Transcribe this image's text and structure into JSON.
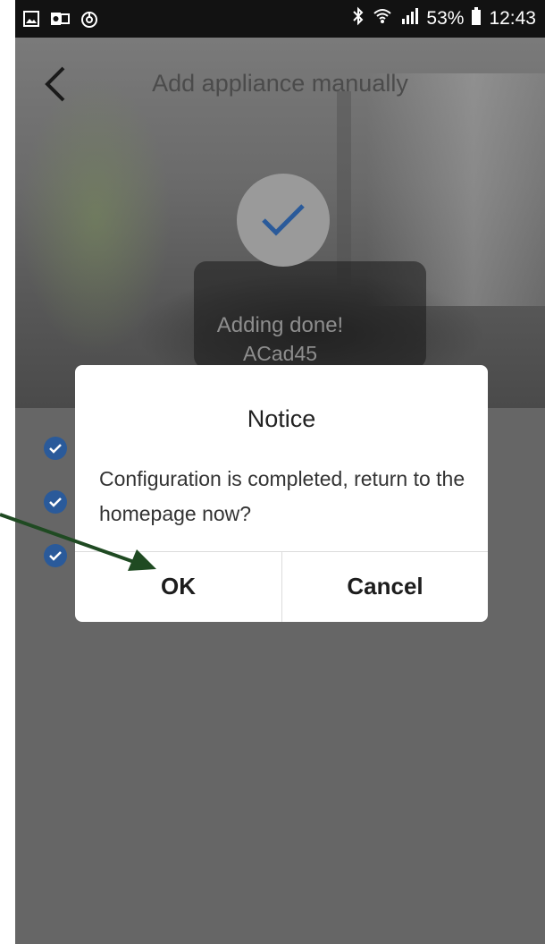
{
  "status_bar": {
    "battery": "53%",
    "time": "12:43",
    "icons_left": [
      "gallery-icon",
      "outlook-icon",
      "sync-icon"
    ],
    "icons_right": [
      "bluetooth-icon",
      "wifi-icon",
      "signal-icon",
      "battery-icon"
    ]
  },
  "header": {
    "title": "Add appliance manually",
    "back_icon": "chevron-left-icon"
  },
  "status": {
    "message": "Adding done!",
    "device_name": "ACad45"
  },
  "dialog": {
    "title": "Notice",
    "message": "Configuration is completed, return to the homepage now?",
    "ok_label": "OK",
    "cancel_label": "Cancel"
  },
  "colors": {
    "accent": "#2a5a9a",
    "overlay": "#666666",
    "annotation_arrow": "#1f4a22"
  }
}
